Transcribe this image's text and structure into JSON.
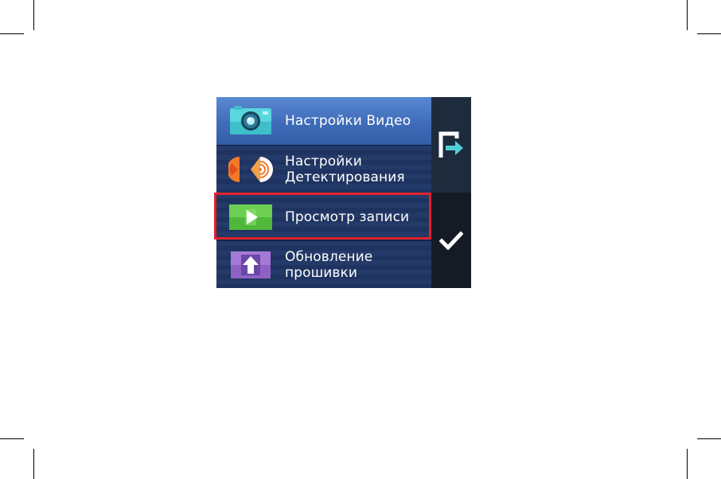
{
  "menu": {
    "items": [
      {
        "icon": "camera-icon",
        "lines": [
          "Настройки Видео"
        ],
        "active": true
      },
      {
        "icon": "detection-icon",
        "lines": [
          "Настройки",
          "Детектирования"
        ],
        "active": false
      },
      {
        "icon": "play-icon",
        "lines": [
          "Просмотр записи"
        ],
        "active": false,
        "highlighted": true
      },
      {
        "icon": "upload-icon",
        "lines": [
          "Обновление",
          "прошивки"
        ],
        "active": false
      }
    ]
  },
  "sidebar": {
    "top_icon": "exit-icon",
    "bottom_icon": "checkmark-icon"
  },
  "colors": {
    "highlight_border": "#e0222b",
    "active_item": "#4a78c4",
    "menu_bg": "#243a68",
    "accent_teal": "#4fd0d6"
  }
}
